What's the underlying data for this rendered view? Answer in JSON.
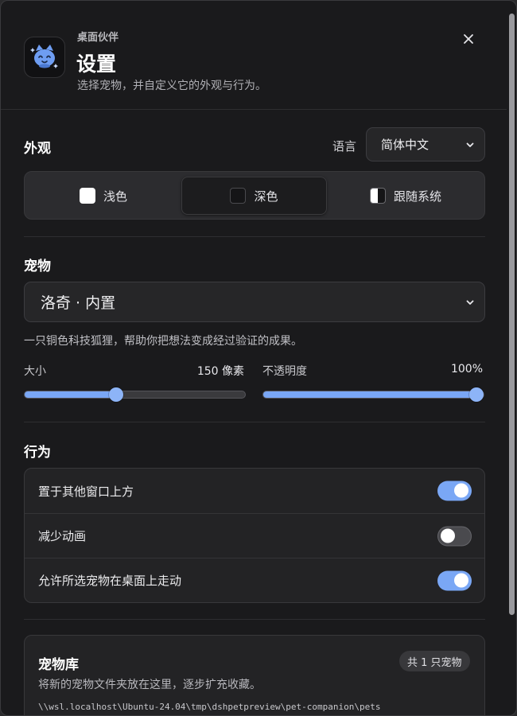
{
  "header": {
    "app_name": "桌面伙伴",
    "title": "设置",
    "subtitle": "选择宠物，并自定义它的外观与行为。",
    "close_symbol": "×"
  },
  "appearance": {
    "section_title": "外观",
    "language_label": "语言",
    "language_value": "简体中文",
    "themes": [
      {
        "label": "浅色",
        "selected": false
      },
      {
        "label": "深色",
        "selected": true
      },
      {
        "label": "跟随系统",
        "selected": false
      }
    ]
  },
  "pet": {
    "section_title": "宠物",
    "selected": "洛奇 · 内置",
    "description": "一只铜色科技狐狸，帮助你把想法变成经过验证的成果。",
    "size": {
      "label": "大小",
      "value_text": "150 像素",
      "fraction": 0.41
    },
    "opacity": {
      "label": "不透明度",
      "value_text": "100%",
      "fraction": 1.0
    }
  },
  "behavior": {
    "section_title": "行为",
    "toggles": [
      {
        "label": "置于其他窗口上方",
        "on": true
      },
      {
        "label": "减少动画",
        "on": false
      },
      {
        "label": "允许所选宠物在桌面上走动",
        "on": true
      }
    ]
  },
  "library": {
    "title": "宠物库",
    "badge": "共 1 只宠物",
    "description": "将新的宠物文件夹放在这里，逐步扩充收藏。",
    "path": "\\\\wsl.localhost\\Ubuntu-24.04\\tmp\\dshpetpreview\\pet-companion\\pets"
  },
  "colors": {
    "accent": "#7aa7f5",
    "background": "#1a1a1c",
    "card": "#232325"
  },
  "icons": {
    "app": "cat-face-icon",
    "close": "close-icon",
    "dropdown": "chevron-down-icon"
  }
}
